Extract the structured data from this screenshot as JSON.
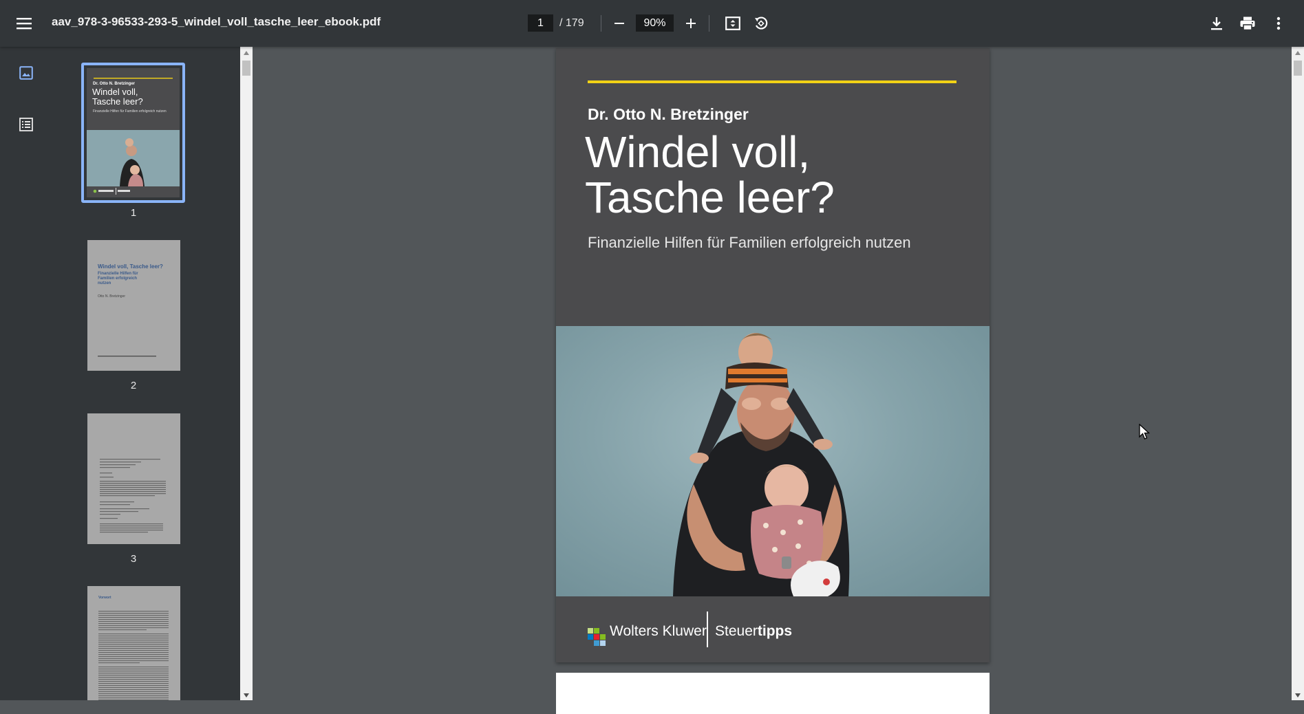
{
  "toolbar": {
    "filename": "aav_978-3-96533-293-5_windel_voll_tasche_leer_ebook.pdf",
    "current_page": "1",
    "total_pages": "/ 179",
    "zoom": "90%"
  },
  "icons": {
    "menu": "hamburger-menu-icon",
    "zoom_out": "minus-icon",
    "zoom_in": "plus-icon",
    "fit": "fit-to-page-icon",
    "rotate": "rotate-counterclockwise-icon",
    "download": "download-icon",
    "print": "print-icon",
    "more": "more-vert-icon",
    "thumbnails": "image-icon",
    "outline": "list-icon"
  },
  "thumbnails": [
    {
      "number": "1",
      "selected": true,
      "cover_author": "Dr. Otto N. Bretzinger",
      "cover_title": "Windel voll, Tasche leer?",
      "cover_subtitle": "Finanzielle Hilfen für Familien erfolgreich nutzen"
    },
    {
      "number": "2",
      "selected": false,
      "title": "Windel voll, Tasche leer?",
      "subtitle": "Finanzielle Hilfen für Familien erfolgreich nutzen",
      "author": "Otto N. Bretzinger"
    },
    {
      "number": "3",
      "selected": false
    },
    {
      "number": "4",
      "selected": false,
      "heading": "Vorwort"
    }
  ],
  "document": {
    "author": "Dr. Otto N. Bretzinger",
    "title_line1": "Windel voll,",
    "title_line2": "Tasche leer?",
    "subtitle": "Finanzielle Hilfen für Familien erfolgreich nutzen",
    "publisher": "Wolters Kluwer",
    "imprint_regular": "Steuer",
    "imprint_bold": "tipps"
  },
  "colors": {
    "toolbar": "#323639",
    "viewer_bg": "#525659",
    "cover_bg": "#4b4b4d",
    "accent_yellow": "#f2d216",
    "thumb_selection": "#8ab4f8"
  }
}
